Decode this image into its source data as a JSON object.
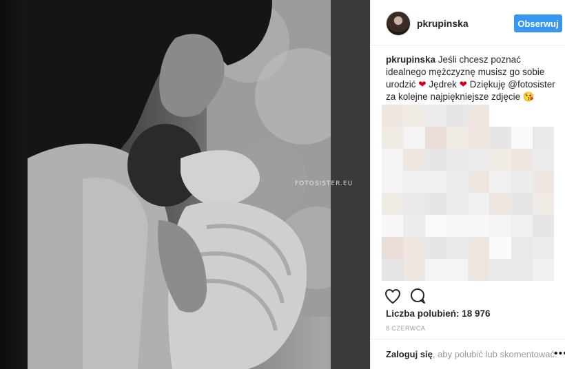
{
  "photo": {
    "watermark": "FOTOSISTER.EU"
  },
  "post": {
    "username": "pkrupinska",
    "follow_label": "Obserwuj",
    "caption_user": "pkrupinska",
    "caption_part1": "Jeśli chcesz poznać idealnego mężczyznę musisz go sobie urodzić",
    "caption_part2": "Jędrek",
    "caption_part3": "Dziękuję",
    "caption_mention": "@fotosister",
    "caption_part4": "za kolejne najpiękniejsze zdjęcie",
    "heart_glyph": "❤",
    "emoji_glyph": "😘",
    "likes_text": "Liczba polubień: 18 976",
    "date": "8 CZERWCA"
  },
  "footer": {
    "login_link": "Zaloguj się",
    "login_rest": ", aby polubić lub skomentować.",
    "more_glyph": "•••"
  },
  "colors": {
    "accent": "#3897f0",
    "heart": "#d0021b"
  }
}
